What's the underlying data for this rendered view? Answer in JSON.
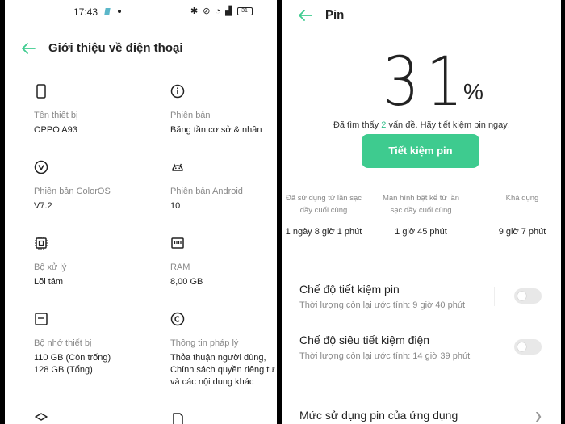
{
  "status_bar": {
    "time": "17:43",
    "battery": "31"
  },
  "about": {
    "title": "Giới thiệu về điện thoại",
    "items": [
      {
        "icon": "phone-icon",
        "label": "Tên thiết bị",
        "value": "OPPO A93"
      },
      {
        "icon": "info-icon",
        "label": "Phiên bản",
        "value": "Băng tần cơ sở & nhân"
      },
      {
        "icon": "coloros-icon",
        "label": "Phiên bản ColorOS",
        "value": "V7.2"
      },
      {
        "icon": "android-icon",
        "label": "Phiên bản Android",
        "value": "10"
      },
      {
        "icon": "processor-icon",
        "label": "Bộ xử lý",
        "value": "Lõi tám"
      },
      {
        "icon": "ram-icon",
        "label": "RAM",
        "value": "8,00 GB"
      },
      {
        "icon": "storage-icon",
        "label": "Bộ nhớ thiết bị",
        "value_lines": [
          "110 GB (Còn trống)",
          "128 GB (Tổng)"
        ]
      },
      {
        "icon": "copyright-icon",
        "label": "Thông tin pháp lý",
        "value_lines": [
          "Thỏa thuận người dùng,",
          "Chính sách quyền riêng tư",
          "và các nội dung khác"
        ]
      }
    ]
  },
  "battery": {
    "title": "Pin",
    "percent": "31",
    "percent_sign": "%",
    "issues_prefix": "Đã tìm thấy",
    "issues_count": "2",
    "issues_suffix": "vấn đề. Hãy tiết kiệm pin ngay.",
    "save_button": "Tiết kiệm pin",
    "stats": [
      {
        "label_lines": [
          "Đã sử dụng từ lần sạc",
          "đầy cuối cùng"
        ],
        "value": "1 ngày 8 giờ 1 phút"
      },
      {
        "label_lines": [
          "Màn hình bật kể từ lần",
          "sạc đầy cuối cùng"
        ],
        "value": "1 giờ 45 phút"
      },
      {
        "label_lines": [
          "Khả dụng"
        ],
        "value": "9 giờ 7 phút"
      }
    ],
    "modes": [
      {
        "title": "Chế độ tiết kiệm pin",
        "subtitle": "Thời lượng còn lại ước tính:  9 giờ 40 phút",
        "enabled": false
      },
      {
        "title": "Chế độ siêu tiết kiệm điện",
        "subtitle": "Thời lượng còn lại ước tính:  14 giờ 39 phút",
        "enabled": false
      }
    ],
    "usage_link": "Mức sử dụng pin của ứng dụng"
  },
  "colors": {
    "accent": "#3ecb8f",
    "accent_text": "#2fbf8a",
    "label": "#888888",
    "text": "#222222"
  }
}
